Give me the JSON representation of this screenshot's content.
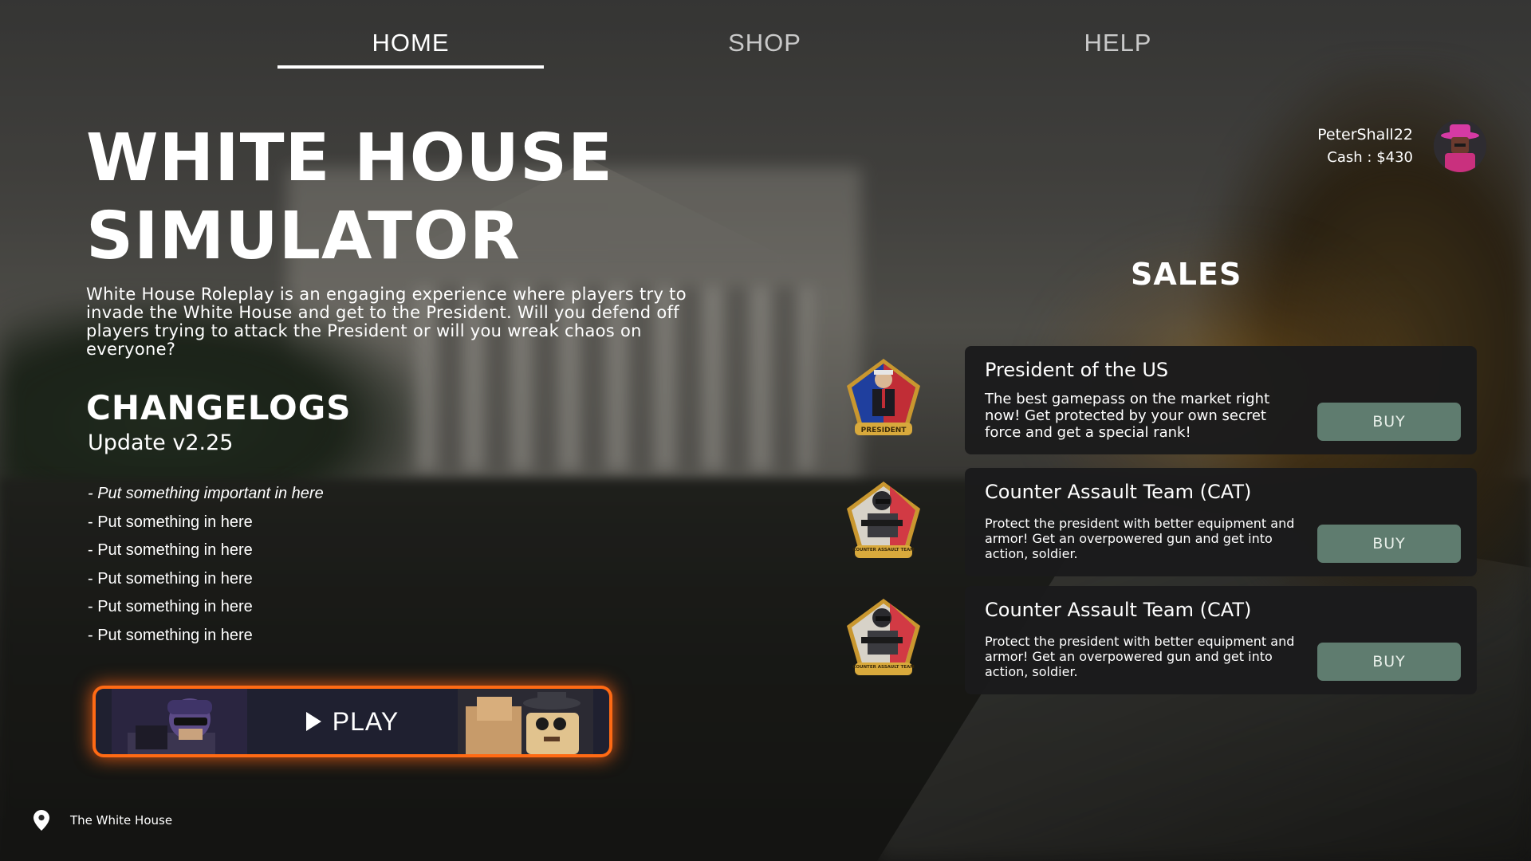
{
  "nav": {
    "tabs": [
      {
        "label": "HOME",
        "active": true
      },
      {
        "label": "SHOP",
        "active": false
      },
      {
        "label": "HELP",
        "active": false
      }
    ]
  },
  "game": {
    "title_line1": "WHITE HOUSE",
    "title_line2": "SIMULATOR",
    "description": "White House Roleplay is an engaging experience where players try to invade the White House and get to the President. Will you defend off players trying to attack the President or will you wreak chaos on everyone?"
  },
  "changelogs": {
    "title": "CHANGELOGS",
    "version": "Update v2.25",
    "items": [
      "- Put something important in here",
      "- Put something in here",
      "- Put something in here",
      "- Put something in here",
      "- Put something in here",
      "- Put something in here"
    ]
  },
  "play": {
    "label": "PLAY"
  },
  "location": {
    "name": "The White House"
  },
  "profile": {
    "username": "PeterShall22",
    "cash": "Cash : $430"
  },
  "sales": {
    "title": "SALES",
    "items": [
      {
        "title": "President of the US",
        "description": "The best gamepass on the market right now! Get protected by your own secret force and get a special rank!",
        "buy_label": "BUY",
        "badge_text": "PRESIDENT"
      },
      {
        "title": "Counter Assault Team (CAT)",
        "description": "Protect the president with better equipment and armor! Get an overpowered gun and get into action, soldier.",
        "buy_label": "BUY",
        "badge_text": "COUNTER ASSAULT TEAM"
      },
      {
        "title": "Counter Assault Team (CAT)",
        "description": "Protect the president with better equipment and armor! Get an overpowered gun and get into action, soldier.",
        "buy_label": "BUY",
        "badge_text": "COUNTER ASSAULT TEAM"
      }
    ]
  },
  "colors": {
    "play_glow": "#ff6a14",
    "buy_button": "#5f7c6f",
    "card_bg": "#1b1b1c"
  },
  "icons": {
    "location": "map-pin-icon",
    "play": "play-triangle-icon"
  }
}
